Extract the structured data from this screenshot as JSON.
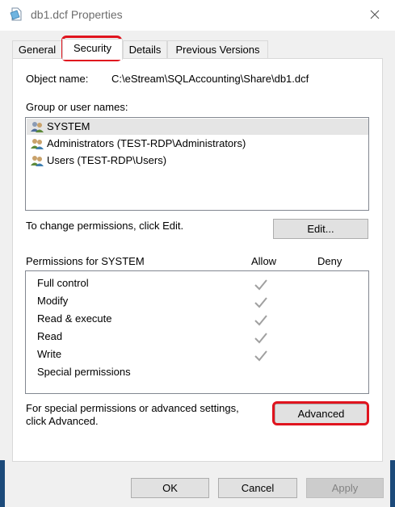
{
  "window": {
    "title": "db1.dcf Properties",
    "icon": "document-file-icon",
    "close_glyph": "✕"
  },
  "tabs": [
    {
      "label": "General",
      "active": false
    },
    {
      "label": "Security",
      "active": true
    },
    {
      "label": "Details",
      "active": false
    },
    {
      "label": "Previous Versions",
      "active": false
    }
  ],
  "security": {
    "object_name_label": "Object name:",
    "object_name_value": "C:\\eStream\\SQLAccounting\\Share\\db1.dcf",
    "group_label": "Group or user names:",
    "groups": [
      {
        "name": "SYSTEM",
        "selected": true
      },
      {
        "name": "Administrators (TEST-RDP\\Administrators)",
        "selected": false
      },
      {
        "name": "Users (TEST-RDP\\Users)",
        "selected": false
      }
    ],
    "change_text": "To change permissions, click Edit.",
    "edit_label": "Edit...",
    "permissions_label": "Permissions for SYSTEM",
    "allow_header": "Allow",
    "deny_header": "Deny",
    "permissions": [
      {
        "name": "Full control",
        "allow": true,
        "deny": false
      },
      {
        "name": "Modify",
        "allow": true,
        "deny": false
      },
      {
        "name": "Read & execute",
        "allow": true,
        "deny": false
      },
      {
        "name": "Read",
        "allow": true,
        "deny": false
      },
      {
        "name": "Write",
        "allow": true,
        "deny": false
      },
      {
        "name": "Special permissions",
        "allow": false,
        "deny": false
      }
    ],
    "advanced_text_line1": "For special permissions or advanced settings,",
    "advanced_text_line2": "click Advanced.",
    "advanced_label": "Advanced"
  },
  "footer": {
    "ok_label": "OK",
    "cancel_label": "Cancel",
    "apply_label": "Apply",
    "apply_disabled": true
  },
  "colors": {
    "highlight": "#e0141e",
    "check": "#a0a0a0",
    "selected_row": "#e5e5e5"
  }
}
